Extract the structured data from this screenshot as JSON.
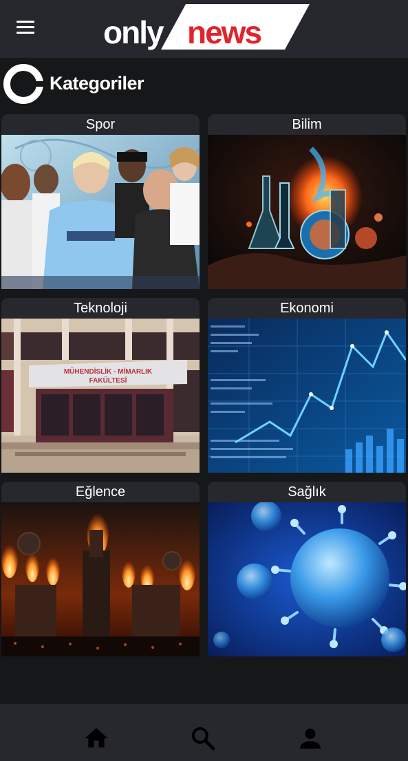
{
  "header": {
    "menu_icon": "hamburger-menu-icon",
    "logo_part1": "only",
    "logo_part2": "news",
    "logo_accent": "#e0242c"
  },
  "section": {
    "title": "Kategoriler",
    "icon": "ring-icon"
  },
  "categories": [
    {
      "label": "Spor",
      "image": "sports-stars-photo"
    },
    {
      "label": "Bilim",
      "image": "science-flasks-illustration"
    },
    {
      "label": "Teknoloji",
      "image": "engineering-faculty-building-photo",
      "sign_line1": "MÜHENDİSLİK - MİMARLIK",
      "sign_line2": "FAKÜLTESİ"
    },
    {
      "label": "Ekonomi",
      "image": "stock-market-chart-photo"
    },
    {
      "label": "Eğlence",
      "image": "concert-fire-stage-photo"
    },
    {
      "label": "Sağlık",
      "image": "virus-illustration"
    }
  ],
  "bottom_nav": {
    "home_icon": "home-icon",
    "search_icon": "search-icon",
    "profile_icon": "profile-icon"
  },
  "colors": {
    "background": "#161718",
    "bar": "#26282d",
    "text": "#ffffff"
  }
}
